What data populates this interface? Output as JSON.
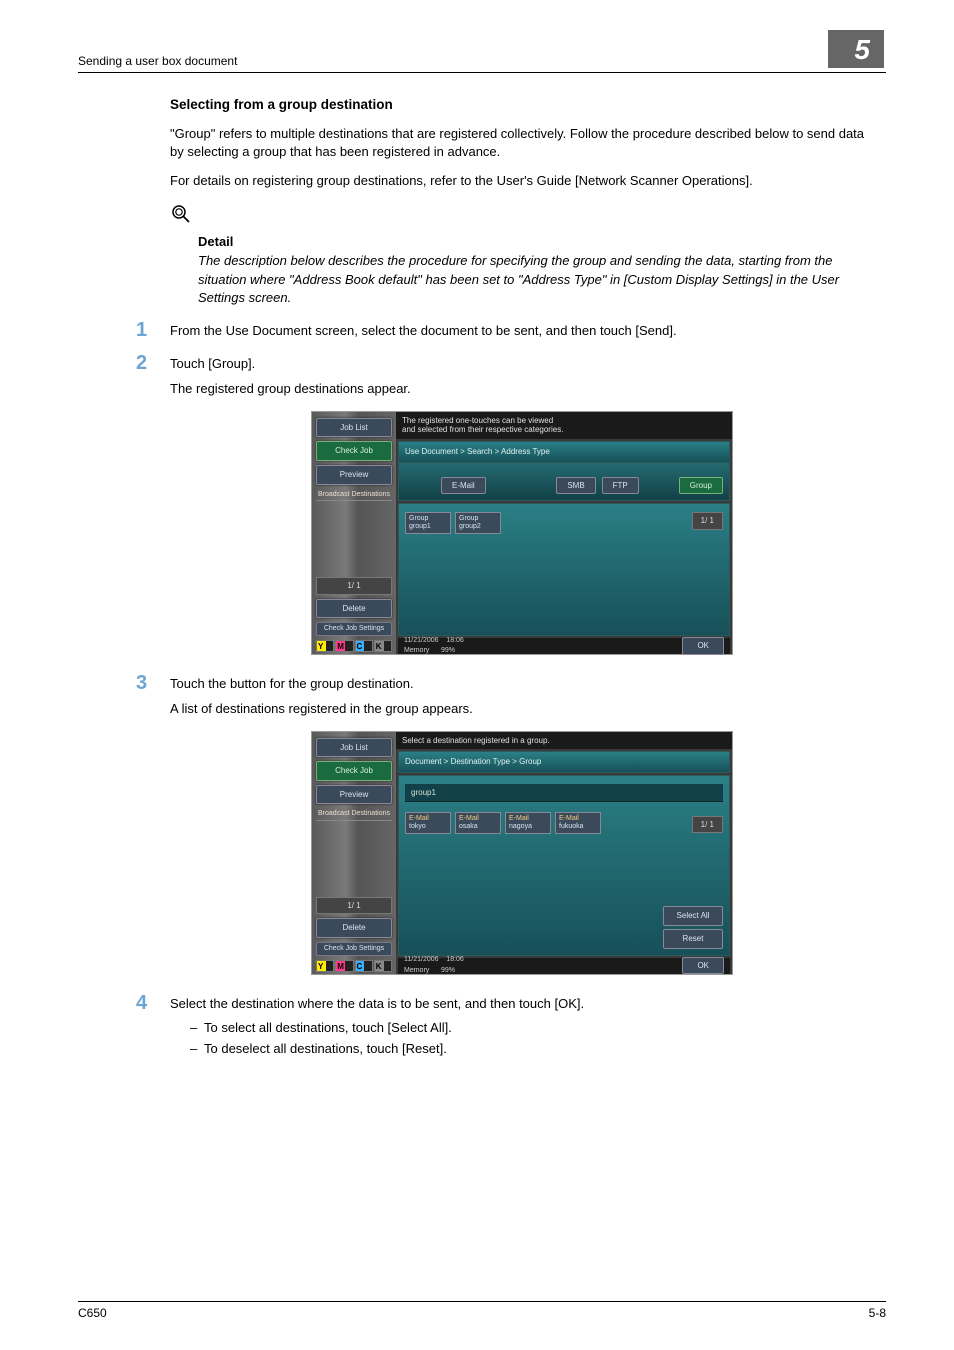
{
  "page_header": {
    "left": "Sending a user box document",
    "chapter": "5"
  },
  "section_title": "Selecting from a group destination",
  "paragraphs": {
    "p1": "\"Group\" refers to multiple destinations that are registered collectively. Follow the procedure described below to send data by selecting a group that has been registered in advance.",
    "p2": "For details on registering group destinations, refer to the User's Guide [Network Scanner Operations]."
  },
  "detail": {
    "label": "Detail",
    "text": "The description below describes the procedure for specifying the group and sending the data, starting from the situation where \"Address Book default\" has been set to \"Address Type\" in [Custom Display Settings] in the User Settings screen."
  },
  "steps": {
    "s1": {
      "num": "1",
      "text": "From the Use Document screen, select the document to be sent, and then touch [Send]."
    },
    "s2": {
      "num": "2",
      "text": "Touch [Group].",
      "sub": "The registered group destinations appear."
    },
    "s3": {
      "num": "3",
      "text": "Touch the button for the group destination.",
      "sub": "A list of destinations registered in the group appears."
    },
    "s4": {
      "num": "4",
      "text": "Select the destination where the data is to be sent, and then touch [OK].",
      "bullets": {
        "b1": "To select all destinations, touch [Select All].",
        "b2": "To deselect all destinations, touch [Reset]."
      }
    }
  },
  "screenshot_common": {
    "side": {
      "job_list": "Job List",
      "check_job": "Check Job",
      "preview": "Preview",
      "broadcast": "Broadcast Destinations",
      "page": "1/  1",
      "delete": "Delete",
      "check_settings": "Check Job Settings"
    },
    "ymck": {
      "y": "Y",
      "m": "M",
      "c": "C",
      "k": "K"
    },
    "status": {
      "date": "11/21/2006",
      "time": "18:06",
      "memory_label": "Memory",
      "memory": "99%"
    },
    "ok": "OK",
    "page_ind": "1/  1"
  },
  "screenshot1": {
    "msg": "The registered one-touches can be viewed\nand selected from their respective categories.",
    "crumb": "Use Document > Search > Address Type",
    "tabs": {
      "email": "E-Mail",
      "smb": "SMB",
      "ftp": "FTP",
      "group": "Group"
    },
    "items": {
      "g1_type": "Group",
      "g1_name": "group1",
      "g2_type": "Group",
      "g2_name": "group2"
    }
  },
  "screenshot2": {
    "msg": "Select a destination registered in a group.",
    "crumb": "Document > Destination Type > Group",
    "group_name": "group1",
    "items": {
      "i1_type": "E-Mail",
      "i1_name": "tokyo",
      "i2_type": "E-Mail",
      "i2_name": "osaka",
      "i3_type": "E-Mail",
      "i3_name": "nagoya",
      "i4_type": "E-Mail",
      "i4_name": "fukuoka"
    },
    "select_all": "Select All",
    "reset": "Reset"
  },
  "footer": {
    "left": "C650",
    "right": "5-8"
  }
}
